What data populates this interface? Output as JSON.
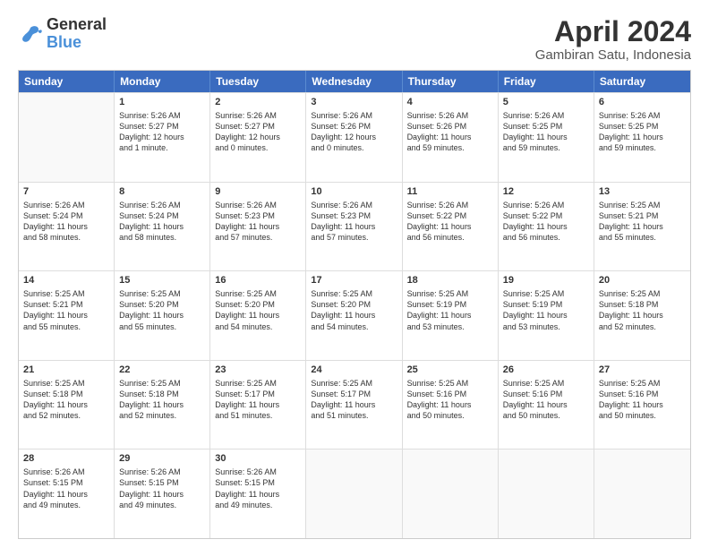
{
  "header": {
    "logo_line1": "General",
    "logo_line2": "Blue",
    "month_year": "April 2024",
    "location": "Gambiran Satu, Indonesia"
  },
  "days_of_week": [
    "Sunday",
    "Monday",
    "Tuesday",
    "Wednesday",
    "Thursday",
    "Friday",
    "Saturday"
  ],
  "weeks": [
    [
      {
        "day": "",
        "info": ""
      },
      {
        "day": "1",
        "info": "Sunrise: 5:26 AM\nSunset: 5:27 PM\nDaylight: 12 hours\nand 1 minute."
      },
      {
        "day": "2",
        "info": "Sunrise: 5:26 AM\nSunset: 5:27 PM\nDaylight: 12 hours\nand 0 minutes."
      },
      {
        "day": "3",
        "info": "Sunrise: 5:26 AM\nSunset: 5:26 PM\nDaylight: 12 hours\nand 0 minutes."
      },
      {
        "day": "4",
        "info": "Sunrise: 5:26 AM\nSunset: 5:26 PM\nDaylight: 11 hours\nand 59 minutes."
      },
      {
        "day": "5",
        "info": "Sunrise: 5:26 AM\nSunset: 5:25 PM\nDaylight: 11 hours\nand 59 minutes."
      },
      {
        "day": "6",
        "info": "Sunrise: 5:26 AM\nSunset: 5:25 PM\nDaylight: 11 hours\nand 59 minutes."
      }
    ],
    [
      {
        "day": "7",
        "info": "Sunrise: 5:26 AM\nSunset: 5:24 PM\nDaylight: 11 hours\nand 58 minutes."
      },
      {
        "day": "8",
        "info": "Sunrise: 5:26 AM\nSunset: 5:24 PM\nDaylight: 11 hours\nand 58 minutes."
      },
      {
        "day": "9",
        "info": "Sunrise: 5:26 AM\nSunset: 5:23 PM\nDaylight: 11 hours\nand 57 minutes."
      },
      {
        "day": "10",
        "info": "Sunrise: 5:26 AM\nSunset: 5:23 PM\nDaylight: 11 hours\nand 57 minutes."
      },
      {
        "day": "11",
        "info": "Sunrise: 5:26 AM\nSunset: 5:22 PM\nDaylight: 11 hours\nand 56 minutes."
      },
      {
        "day": "12",
        "info": "Sunrise: 5:26 AM\nSunset: 5:22 PM\nDaylight: 11 hours\nand 56 minutes."
      },
      {
        "day": "13",
        "info": "Sunrise: 5:25 AM\nSunset: 5:21 PM\nDaylight: 11 hours\nand 55 minutes."
      }
    ],
    [
      {
        "day": "14",
        "info": "Sunrise: 5:25 AM\nSunset: 5:21 PM\nDaylight: 11 hours\nand 55 minutes."
      },
      {
        "day": "15",
        "info": "Sunrise: 5:25 AM\nSunset: 5:20 PM\nDaylight: 11 hours\nand 55 minutes."
      },
      {
        "day": "16",
        "info": "Sunrise: 5:25 AM\nSunset: 5:20 PM\nDaylight: 11 hours\nand 54 minutes."
      },
      {
        "day": "17",
        "info": "Sunrise: 5:25 AM\nSunset: 5:20 PM\nDaylight: 11 hours\nand 54 minutes."
      },
      {
        "day": "18",
        "info": "Sunrise: 5:25 AM\nSunset: 5:19 PM\nDaylight: 11 hours\nand 53 minutes."
      },
      {
        "day": "19",
        "info": "Sunrise: 5:25 AM\nSunset: 5:19 PM\nDaylight: 11 hours\nand 53 minutes."
      },
      {
        "day": "20",
        "info": "Sunrise: 5:25 AM\nSunset: 5:18 PM\nDaylight: 11 hours\nand 52 minutes."
      }
    ],
    [
      {
        "day": "21",
        "info": "Sunrise: 5:25 AM\nSunset: 5:18 PM\nDaylight: 11 hours\nand 52 minutes."
      },
      {
        "day": "22",
        "info": "Sunrise: 5:25 AM\nSunset: 5:18 PM\nDaylight: 11 hours\nand 52 minutes."
      },
      {
        "day": "23",
        "info": "Sunrise: 5:25 AM\nSunset: 5:17 PM\nDaylight: 11 hours\nand 51 minutes."
      },
      {
        "day": "24",
        "info": "Sunrise: 5:25 AM\nSunset: 5:17 PM\nDaylight: 11 hours\nand 51 minutes."
      },
      {
        "day": "25",
        "info": "Sunrise: 5:25 AM\nSunset: 5:16 PM\nDaylight: 11 hours\nand 50 minutes."
      },
      {
        "day": "26",
        "info": "Sunrise: 5:25 AM\nSunset: 5:16 PM\nDaylight: 11 hours\nand 50 minutes."
      },
      {
        "day": "27",
        "info": "Sunrise: 5:25 AM\nSunset: 5:16 PM\nDaylight: 11 hours\nand 50 minutes."
      }
    ],
    [
      {
        "day": "28",
        "info": "Sunrise: 5:26 AM\nSunset: 5:15 PM\nDaylight: 11 hours\nand 49 minutes."
      },
      {
        "day": "29",
        "info": "Sunrise: 5:26 AM\nSunset: 5:15 PM\nDaylight: 11 hours\nand 49 minutes."
      },
      {
        "day": "30",
        "info": "Sunrise: 5:26 AM\nSunset: 5:15 PM\nDaylight: 11 hours\nand 49 minutes."
      },
      {
        "day": "",
        "info": ""
      },
      {
        "day": "",
        "info": ""
      },
      {
        "day": "",
        "info": ""
      },
      {
        "day": "",
        "info": ""
      }
    ]
  ]
}
